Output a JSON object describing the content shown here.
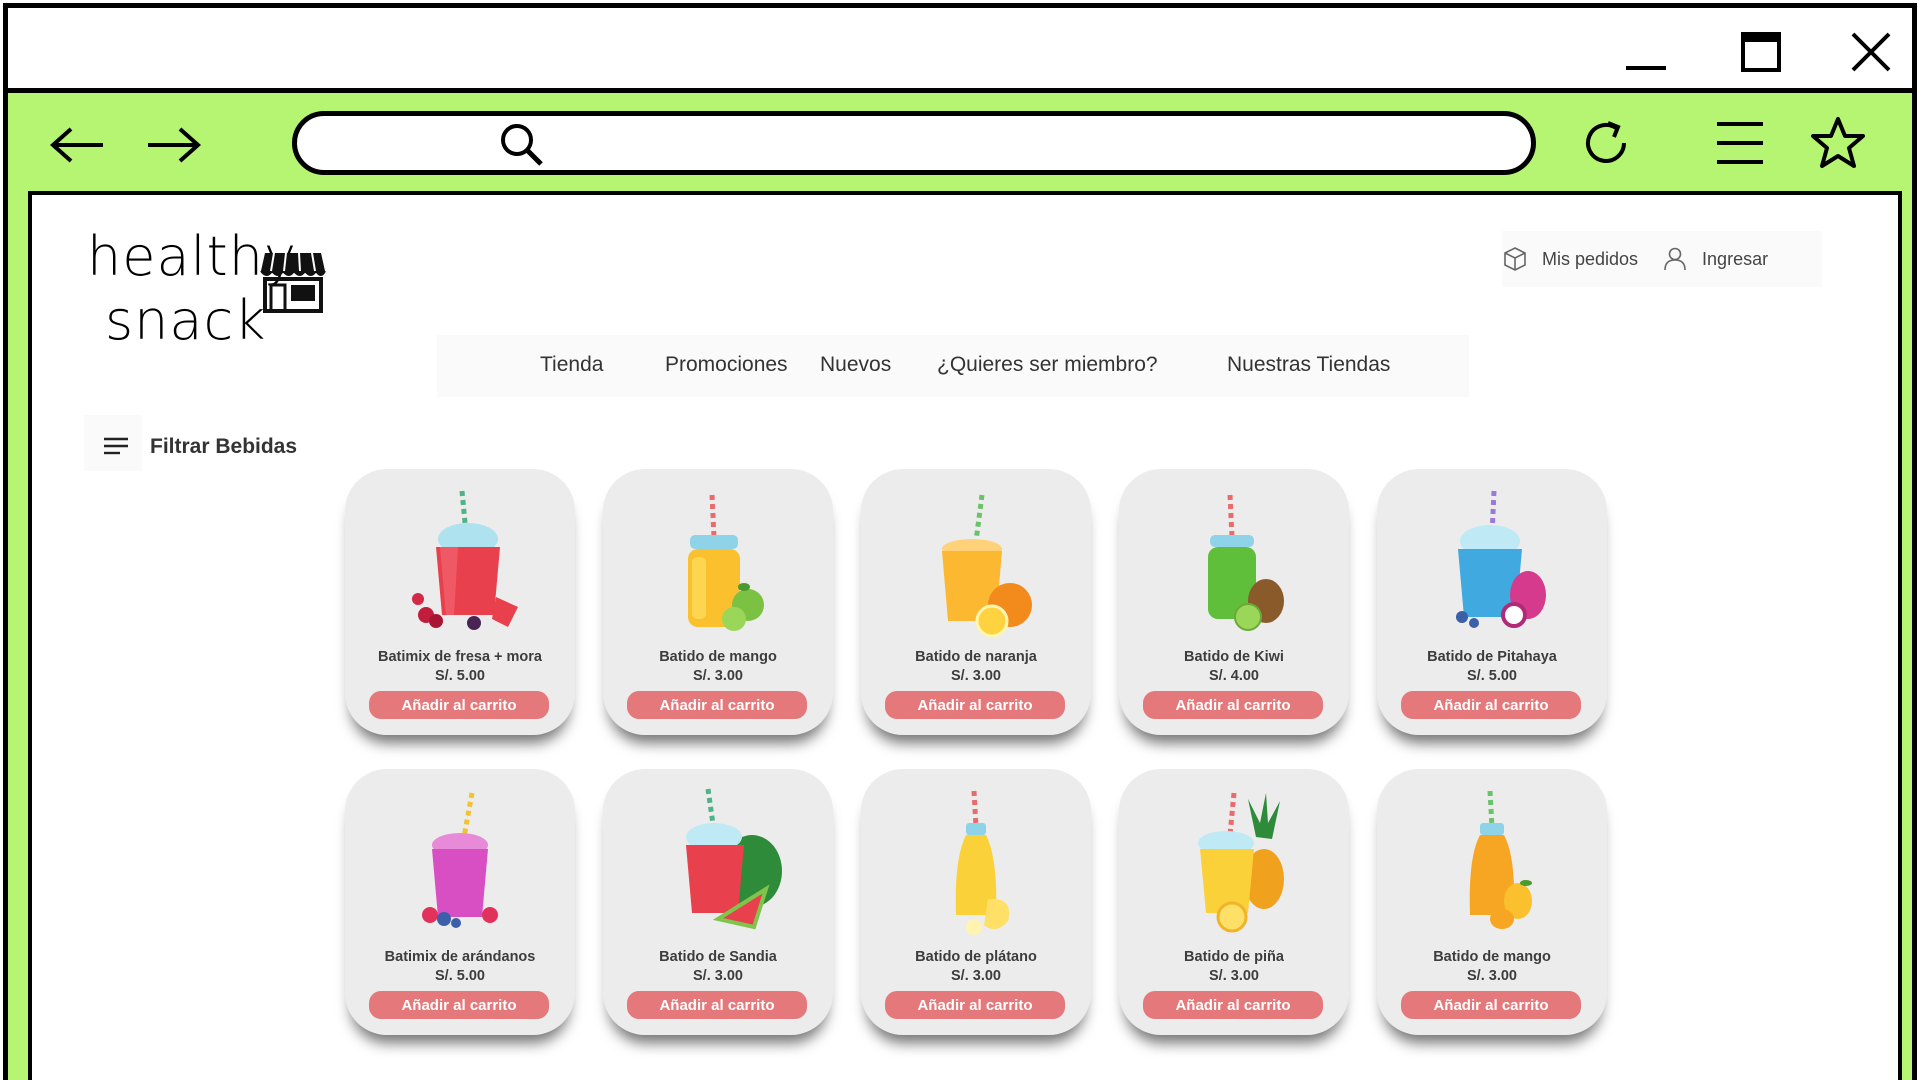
{
  "browser": {
    "window_controls": [
      "minimize-icon",
      "maximize-icon",
      "close-icon"
    ],
    "nav": [
      "arrow-left-icon",
      "arrow-right-icon"
    ],
    "address": {
      "value": "",
      "placeholder": ""
    },
    "actions": [
      "reload-icon",
      "menu-icon",
      "star-icon"
    ],
    "accent_color": "#b6f572"
  },
  "site": {
    "logo": {
      "line1": "healthy",
      "line2": "snack",
      "icon": "store-icon"
    },
    "account": {
      "orders_label": "Mis pedidos",
      "orders_icon": "box-icon",
      "login_label": "Ingresar",
      "login_icon": "user-icon"
    },
    "menu": [
      "Tienda",
      "Promociones",
      "Nuevos",
      "¿Quieres ser miembro?",
      "Nuestras Tiendas"
    ],
    "filter": {
      "label": "Filtrar Bebidas",
      "icon": "filter-lines-icon"
    },
    "button_color": "#e5787a",
    "products": [
      {
        "name": "Batimix de fresa + mora",
        "price": "S/. 5.00",
        "button": "Añadir al carrito",
        "icon": "strawberry-blackberry-smoothie-icon"
      },
      {
        "name": "Batido de mango",
        "price": "S/. 3.00",
        "button": "Añadir al carrito",
        "icon": "mango-smoothie-icon"
      },
      {
        "name": "Batido de naranja",
        "price": "S/. 3.00",
        "button": "Añadir al carrito",
        "icon": "orange-smoothie-icon"
      },
      {
        "name": "Batido de Kiwi",
        "price": "S/. 4.00",
        "button": "Añadir al carrito",
        "icon": "kiwi-smoothie-icon"
      },
      {
        "name": "Batido de Pitahaya",
        "price": "S/. 5.00",
        "button": "Añadir al carrito",
        "icon": "pitahaya-smoothie-icon"
      },
      {
        "name": "Batimix de  arándanos",
        "price": "S/. 5.00",
        "button": "Añadir al carrito",
        "icon": "blueberry-smoothie-icon"
      },
      {
        "name": "Batido de Sandia",
        "price": "S/. 3.00",
        "button": "Añadir al carrito",
        "icon": "watermelon-smoothie-icon"
      },
      {
        "name": "Batido de plátano",
        "price": "S/. 3.00",
        "button": "Añadir al carrito",
        "icon": "banana-smoothie-icon"
      },
      {
        "name": "Batido de piña",
        "price": "S/. 3.00",
        "button": "Añadir al carrito",
        "icon": "pineapple-smoothie-icon"
      },
      {
        "name": "Batido de mango",
        "price": "S/. 3.00",
        "button": "Añadir al carrito",
        "icon": "mango-bottle-smoothie-icon"
      }
    ]
  }
}
